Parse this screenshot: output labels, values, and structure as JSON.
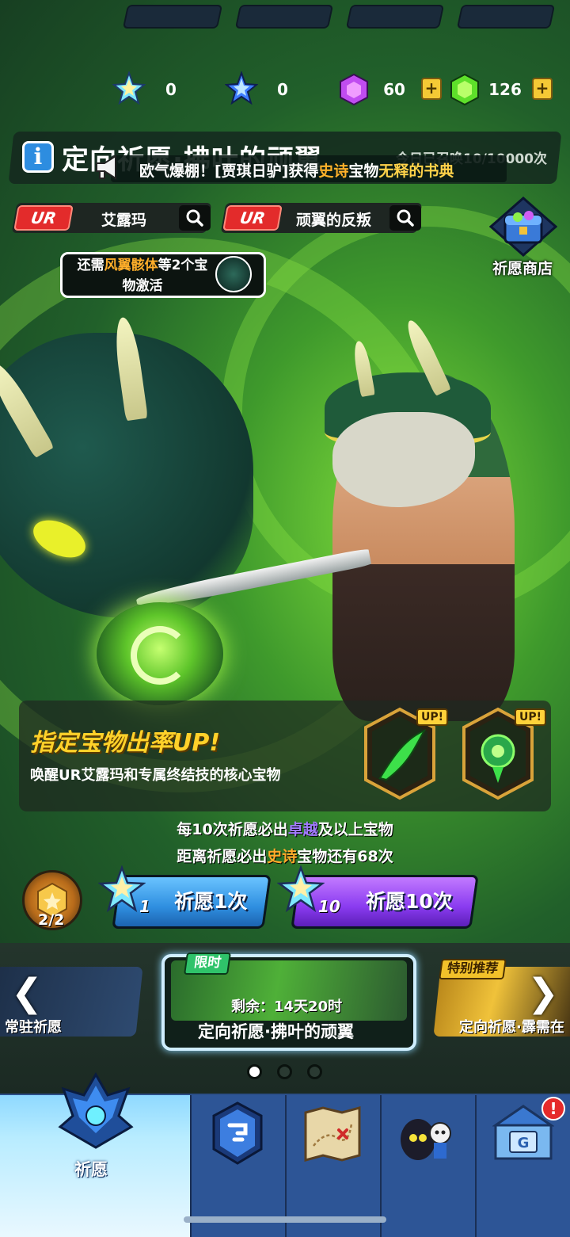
{
  "currency": {
    "blue_star": "0",
    "crystal_star": "0",
    "purple_gem": "60",
    "green_gem": "126",
    "plus": "+"
  },
  "banner": {
    "info": "i",
    "title": "定向祈愿·拂叶的顽翼",
    "summon_count": "今日已召唤10/10000次",
    "ticker_prefix": "欧气爆棚！[贾琪日驴]获得",
    "ticker_rarity": "史诗",
    "ticker_mid": "宝物",
    "ticker_item": "无释的书典"
  },
  "ur_tags": [
    {
      "badge": "UR",
      "name": "艾露玛"
    },
    {
      "badge": "UR",
      "name": "顽翼的反叛"
    }
  ],
  "hint": {
    "prefix": "还需",
    "item": "风翼骸体",
    "suffix": "等2个宝物激活"
  },
  "shop": {
    "label": "祈愿商店"
  },
  "rate_up": {
    "title": "指定宝物出率UP!",
    "description": "唤醒UR艾露玛和专属终结技的核心宝物",
    "up_tag": "UP!"
  },
  "guarantee": {
    "line1_prefix": "每10次祈愿必出",
    "line1_rarity": "卓越",
    "line1_suffix": "及以上宝物",
    "line2_prefix": "距离祈愿必出",
    "line2_rarity": "史诗",
    "line2_suffix": "宝物还有68次"
  },
  "token": {
    "count": "2/2"
  },
  "pray": {
    "one_cost": "1",
    "one_label": "祈愿1次",
    "ten_cost": "10",
    "ten_label": "祈愿10次"
  },
  "carousel": {
    "left_label": "常驻祈愿",
    "center_tag": "限时",
    "center_remain": "剩余：14天20时",
    "center_label": "定向祈愿·拂叶的顽翼",
    "right_tag": "特别推荐",
    "right_label": "定向祈愿·霹需在",
    "prev": "❮",
    "next": "❯",
    "page_dots": 3,
    "active_dot": 1
  },
  "nav": {
    "active_label": "祈愿",
    "alert": "!"
  },
  "colors": {
    "rarity_epic": "#ffaa2a",
    "rarity_excellent": "#a27aff",
    "ur_red": "#e32b2b",
    "pray_one": "#2f8fe0",
    "pray_ten": "#8a3bf0"
  }
}
